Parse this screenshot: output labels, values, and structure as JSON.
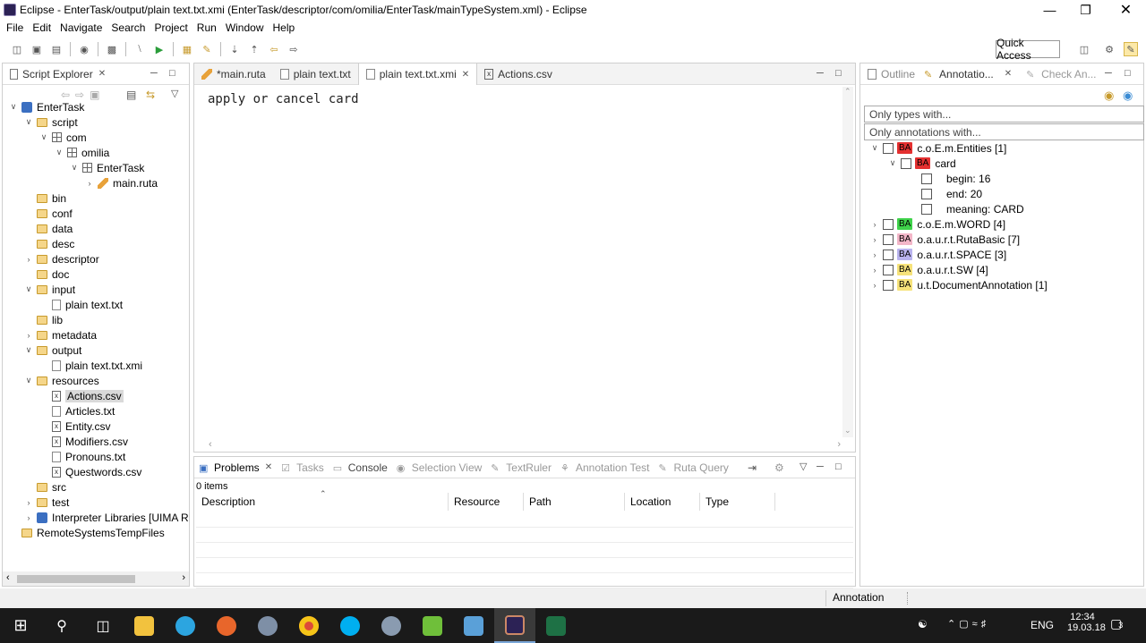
{
  "window": {
    "title": "Eclipse - EnterTask/output/plain text.txt.xmi (EnterTask/descriptor/com/omilia/EnterTask/mainTypeSystem.xml) - Eclipse"
  },
  "menu": [
    "File",
    "Edit",
    "Navigate",
    "Search",
    "Project",
    "Run",
    "Window",
    "Help"
  ],
  "quick_access": "Quick Access",
  "explorer": {
    "tab": "Script Explorer",
    "items": [
      {
        "label": "EnterTask",
        "depth": 0,
        "icon": "project-icon",
        "twisty": "open"
      },
      {
        "label": "script",
        "depth": 1,
        "icon": "script-folder-icon",
        "twisty": "open"
      },
      {
        "label": "com",
        "depth": 2,
        "icon": "package-icon",
        "twisty": "open"
      },
      {
        "label": "omilia",
        "depth": 3,
        "icon": "package-icon",
        "twisty": "open"
      },
      {
        "label": "EnterTask",
        "depth": 4,
        "icon": "package-icon",
        "twisty": "open"
      },
      {
        "label": "main.ruta",
        "depth": 5,
        "icon": "ruta-file-icon",
        "twisty": "closed"
      },
      {
        "label": "bin",
        "depth": 1,
        "icon": "folder-icon",
        "twisty": ""
      },
      {
        "label": "conf",
        "depth": 1,
        "icon": "folder-icon",
        "twisty": ""
      },
      {
        "label": "data",
        "depth": 1,
        "icon": "folder-icon",
        "twisty": ""
      },
      {
        "label": "desc",
        "depth": 1,
        "icon": "folder-icon",
        "twisty": ""
      },
      {
        "label": "descriptor",
        "depth": 1,
        "icon": "folder-icon",
        "twisty": "closed"
      },
      {
        "label": "doc",
        "depth": 1,
        "icon": "folder-icon",
        "twisty": ""
      },
      {
        "label": "input",
        "depth": 1,
        "icon": "folder-icon",
        "twisty": "open"
      },
      {
        "label": "plain text.txt",
        "depth": 2,
        "icon": "text-file-icon",
        "twisty": ""
      },
      {
        "label": "lib",
        "depth": 1,
        "icon": "folder-icon",
        "twisty": ""
      },
      {
        "label": "metadata",
        "depth": 1,
        "icon": "folder-icon",
        "twisty": "closed"
      },
      {
        "label": "output",
        "depth": 1,
        "icon": "folder-icon",
        "twisty": "open"
      },
      {
        "label": "plain text.txt.xmi",
        "depth": 2,
        "icon": "file-icon",
        "twisty": ""
      },
      {
        "label": "resources",
        "depth": 1,
        "icon": "folder-icon",
        "twisty": "open"
      },
      {
        "label": "Actions.csv",
        "depth": 2,
        "icon": "csv-file-icon",
        "twisty": "",
        "selected": true
      },
      {
        "label": "Articles.txt",
        "depth": 2,
        "icon": "text-file-icon",
        "twisty": ""
      },
      {
        "label": "Entity.csv",
        "depth": 2,
        "icon": "csv-file-icon",
        "twisty": ""
      },
      {
        "label": "Modifiers.csv",
        "depth": 2,
        "icon": "csv-file-icon",
        "twisty": ""
      },
      {
        "label": "Pronouns.txt",
        "depth": 2,
        "icon": "text-file-icon",
        "twisty": ""
      },
      {
        "label": "Questwords.csv",
        "depth": 2,
        "icon": "csv-file-icon",
        "twisty": ""
      },
      {
        "label": "src",
        "depth": 1,
        "icon": "folder-icon",
        "twisty": ""
      },
      {
        "label": "test",
        "depth": 1,
        "icon": "folder-icon",
        "twisty": "closed"
      },
      {
        "label": "Interpreter Libraries [UIMA Ru",
        "depth": 1,
        "icon": "library-icon",
        "twisty": "closed"
      },
      {
        "label": "RemoteSystemsTempFiles",
        "depth": 0,
        "icon": "project-folder-icon",
        "twisty": ""
      }
    ]
  },
  "editor": {
    "tabs": [
      {
        "label": "*main.ruta",
        "icon": "ruta-file-icon"
      },
      {
        "label": "plain text.txt",
        "icon": "text-file-icon"
      },
      {
        "label": "plain text.txt.xmi",
        "icon": "file-icon",
        "active": true
      },
      {
        "label": "Actions.csv",
        "icon": "csv-file-icon"
      }
    ],
    "content": "apply or cancel card"
  },
  "bottom": {
    "tabs": [
      "Problems",
      "Tasks",
      "Console",
      "Selection View",
      "TextRuler",
      "Annotation Test",
      "Ruta Query"
    ],
    "count": "0 items",
    "columns": [
      "Description",
      "Resource",
      "Path",
      "Location",
      "Type"
    ]
  },
  "right": {
    "tabs": [
      "Outline",
      "Annotatio...",
      "Check An..."
    ],
    "filter_types": "Only types with...",
    "filter_annotations": "Only annotations with...",
    "badge": "BA",
    "tree": [
      {
        "label": "c.o.E.m.Entities [1]",
        "color": "#e43030",
        "indent": 0,
        "twisty": "open",
        "badge": true
      },
      {
        "label": "card",
        "color": "#e43030",
        "indent": 1,
        "twisty": "open",
        "badge": true
      },
      {
        "label": "begin: 16",
        "indent": 2,
        "twisty": "",
        "badge": false
      },
      {
        "label": "end: 20",
        "indent": 2,
        "twisty": "",
        "badge": false
      },
      {
        "label": "meaning: CARD",
        "indent": 2,
        "twisty": "",
        "badge": false
      },
      {
        "label": "c.o.E.m.WORD [4]",
        "color": "#3fd24a",
        "indent": 0,
        "twisty": "closed",
        "badge": true
      },
      {
        "label": "o.a.u.r.t.RutaBasic [7]",
        "color": "#f3b6c8",
        "indent": 0,
        "twisty": "closed",
        "badge": true
      },
      {
        "label": "o.a.u.r.t.SPACE [3]",
        "color": "#b9b3ee",
        "indent": 0,
        "twisty": "closed",
        "badge": true
      },
      {
        "label": "o.a.u.r.t.SW [4]",
        "color": "#f6e27a",
        "indent": 0,
        "twisty": "closed",
        "badge": true
      },
      {
        "label": "u.t.DocumentAnnotation [1]",
        "color": "#f6e27a",
        "indent": 0,
        "twisty": "closed",
        "badge": true
      }
    ]
  },
  "status": {
    "label": "Annotation"
  },
  "taskbar": {
    "lang": "ENG",
    "time": "12:34",
    "date": "19.03.18",
    "notif": "3"
  }
}
